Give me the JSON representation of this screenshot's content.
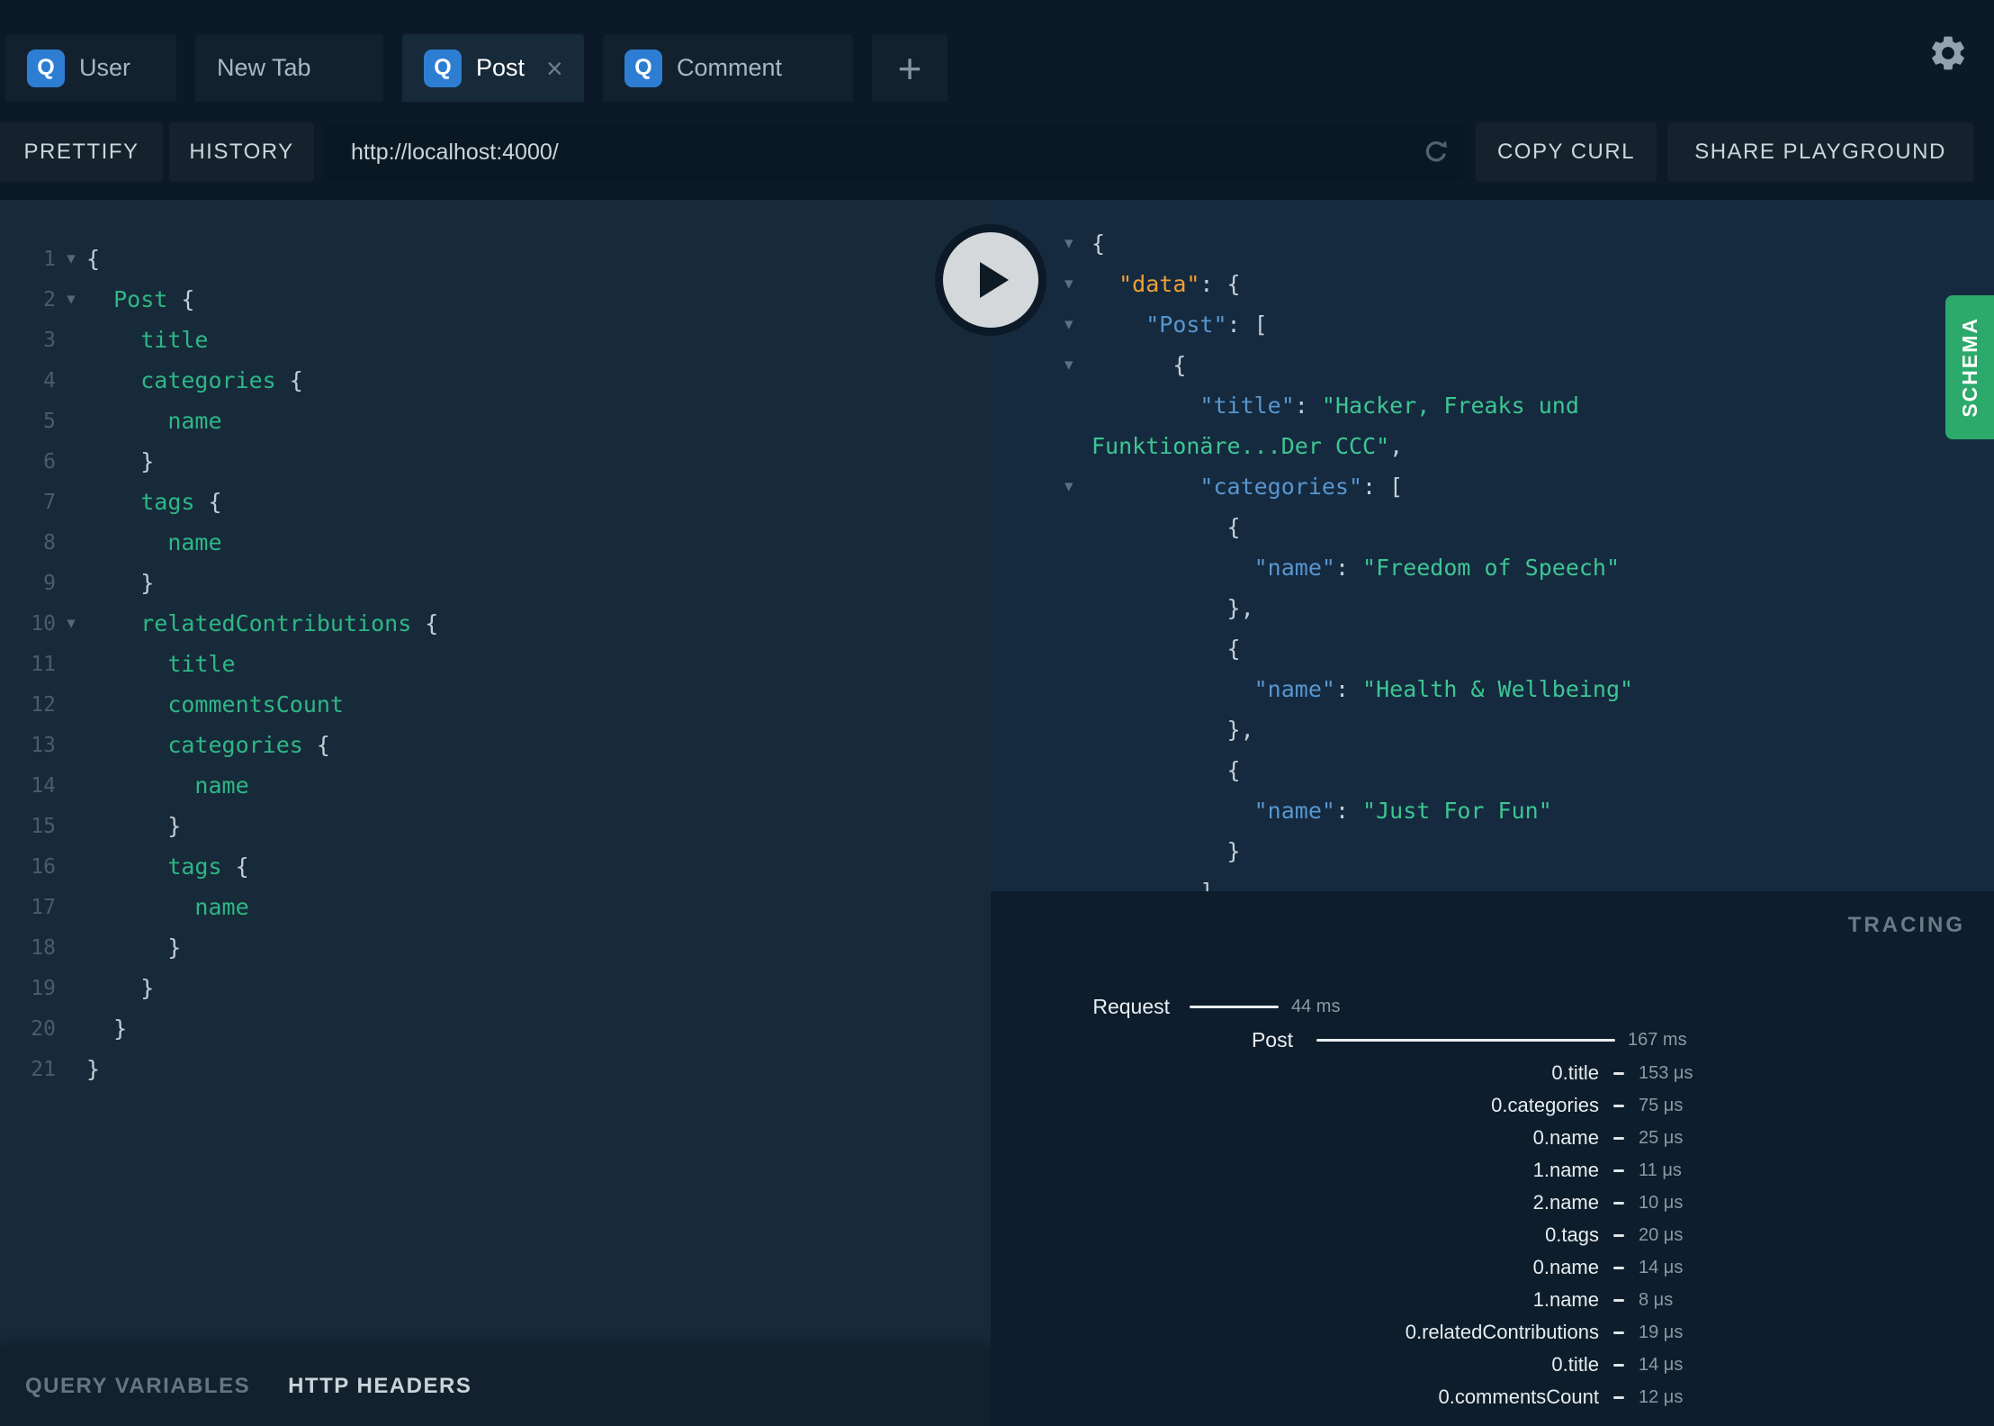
{
  "icons": {
    "q": "Q",
    "close": "×",
    "plus": "+",
    "fold": "▾"
  },
  "tabs": {
    "items": [
      {
        "label": "User",
        "active": false
      },
      {
        "label": "New Tab",
        "active": false
      },
      {
        "label": "Post",
        "active": true
      },
      {
        "label": "Comment",
        "active": false
      }
    ]
  },
  "toolbar": {
    "prettify": "PRETTIFY",
    "history": "HISTORY",
    "url": "http://localhost:4000/",
    "copy_curl": "COPY CURL",
    "share_playground": "SHARE PLAYGROUND"
  },
  "query_editor": {
    "lines": [
      {
        "n": "1",
        "fold": true,
        "tokens": [
          [
            "p",
            "{"
          ]
        ]
      },
      {
        "n": "2",
        "fold": true,
        "tokens": [
          [
            "p",
            "  "
          ],
          [
            "f",
            "Post"
          ],
          [
            "p",
            " {"
          ]
        ]
      },
      {
        "n": "3",
        "fold": false,
        "tokens": [
          [
            "p",
            "    "
          ],
          [
            "f",
            "title"
          ]
        ]
      },
      {
        "n": "4",
        "fold": false,
        "tokens": [
          [
            "p",
            "    "
          ],
          [
            "f",
            "categories"
          ],
          [
            "p",
            " {"
          ]
        ]
      },
      {
        "n": "5",
        "fold": false,
        "tokens": [
          [
            "p",
            "      "
          ],
          [
            "f",
            "name"
          ]
        ]
      },
      {
        "n": "6",
        "fold": false,
        "tokens": [
          [
            "p",
            "    }"
          ]
        ]
      },
      {
        "n": "7",
        "fold": false,
        "tokens": [
          [
            "p",
            "    "
          ],
          [
            "f",
            "tags"
          ],
          [
            "p",
            " {"
          ]
        ]
      },
      {
        "n": "8",
        "fold": false,
        "tokens": [
          [
            "p",
            "      "
          ],
          [
            "f",
            "name"
          ]
        ]
      },
      {
        "n": "9",
        "fold": false,
        "tokens": [
          [
            "p",
            "    }"
          ]
        ]
      },
      {
        "n": "10",
        "fold": true,
        "tokens": [
          [
            "p",
            "    "
          ],
          [
            "f",
            "relatedContributions"
          ],
          [
            "p",
            " {"
          ]
        ]
      },
      {
        "n": "11",
        "fold": false,
        "tokens": [
          [
            "p",
            "      "
          ],
          [
            "f",
            "title"
          ]
        ]
      },
      {
        "n": "12",
        "fold": false,
        "tokens": [
          [
            "p",
            "      "
          ],
          [
            "f",
            "commentsCount"
          ]
        ]
      },
      {
        "n": "13",
        "fold": false,
        "tokens": [
          [
            "p",
            "      "
          ],
          [
            "f",
            "categories"
          ],
          [
            "p",
            " {"
          ]
        ]
      },
      {
        "n": "14",
        "fold": false,
        "tokens": [
          [
            "p",
            "        "
          ],
          [
            "f",
            "name"
          ]
        ]
      },
      {
        "n": "15",
        "fold": false,
        "tokens": [
          [
            "p",
            "      }"
          ]
        ]
      },
      {
        "n": "16",
        "fold": false,
        "tokens": [
          [
            "p",
            "      "
          ],
          [
            "f",
            "tags"
          ],
          [
            "p",
            " {"
          ]
        ]
      },
      {
        "n": "17",
        "fold": false,
        "tokens": [
          [
            "p",
            "        "
          ],
          [
            "f",
            "name"
          ]
        ]
      },
      {
        "n": "18",
        "fold": false,
        "tokens": [
          [
            "p",
            "      }"
          ]
        ]
      },
      {
        "n": "19",
        "fold": false,
        "tokens": [
          [
            "p",
            "    }"
          ]
        ]
      },
      {
        "n": "20",
        "fold": false,
        "tokens": [
          [
            "p",
            "  }"
          ]
        ]
      },
      {
        "n": "21",
        "fold": false,
        "tokens": [
          [
            "p",
            "}"
          ]
        ]
      }
    ]
  },
  "response_viewer": {
    "lines": [
      {
        "fold": true,
        "tokens": [
          [
            "p",
            "{"
          ]
        ]
      },
      {
        "fold": true,
        "tokens": [
          [
            "p",
            "  "
          ],
          [
            "ko",
            "\"data\""
          ],
          [
            "p",
            ": {"
          ]
        ]
      },
      {
        "fold": true,
        "tokens": [
          [
            "p",
            "    "
          ],
          [
            "k",
            "\"Post\""
          ],
          [
            "p",
            ": ["
          ]
        ]
      },
      {
        "fold": true,
        "tokens": [
          [
            "p",
            "      {"
          ]
        ]
      },
      {
        "fold": false,
        "tokens": [
          [
            "p",
            "        "
          ],
          [
            "k",
            "\"title\""
          ],
          [
            "p",
            ": "
          ],
          [
            "s",
            "\"Hacker, Freaks und Funktionäre...Der CCC\""
          ],
          [
            "p",
            ","
          ]
        ]
      },
      {
        "fold": true,
        "tokens": [
          [
            "p",
            "        "
          ],
          [
            "k",
            "\"categories\""
          ],
          [
            "p",
            ": ["
          ]
        ]
      },
      {
        "fold": false,
        "tokens": [
          [
            "p",
            "          {"
          ]
        ]
      },
      {
        "fold": false,
        "tokens": [
          [
            "p",
            "            "
          ],
          [
            "k",
            "\"name\""
          ],
          [
            "p",
            ": "
          ],
          [
            "s",
            "\"Freedom of Speech\""
          ]
        ]
      },
      {
        "fold": false,
        "tokens": [
          [
            "p",
            "          },"
          ]
        ]
      },
      {
        "fold": false,
        "tokens": [
          [
            "p",
            "          {"
          ]
        ]
      },
      {
        "fold": false,
        "tokens": [
          [
            "p",
            "            "
          ],
          [
            "k",
            "\"name\""
          ],
          [
            "p",
            ": "
          ],
          [
            "s",
            "\"Health & Wellbeing\""
          ]
        ]
      },
      {
        "fold": false,
        "tokens": [
          [
            "p",
            "          },"
          ]
        ]
      },
      {
        "fold": false,
        "tokens": [
          [
            "p",
            "          {"
          ]
        ]
      },
      {
        "fold": false,
        "tokens": [
          [
            "p",
            "            "
          ],
          [
            "k",
            "\"name\""
          ],
          [
            "p",
            ": "
          ],
          [
            "s",
            "\"Just For Fun\""
          ]
        ]
      },
      {
        "fold": false,
        "tokens": [
          [
            "p",
            "          }"
          ]
        ]
      },
      {
        "fold": false,
        "tokens": [
          [
            "p",
            "        ]"
          ]
        ]
      }
    ]
  },
  "tracing": {
    "title": "TRACING",
    "request": {
      "label": "Request",
      "time": "44 ms"
    },
    "root": {
      "label": "Post",
      "time": "167 ms"
    },
    "rows": [
      {
        "label": "0.title",
        "time": "153 μs"
      },
      {
        "label": "0.categories",
        "time": "75 μs"
      },
      {
        "label": "0.name",
        "time": "25 μs"
      },
      {
        "label": "1.name",
        "time": "11 μs"
      },
      {
        "label": "2.name",
        "time": "10 μs"
      },
      {
        "label": "0.tags",
        "time": "20 μs"
      },
      {
        "label": "0.name",
        "time": "14 μs"
      },
      {
        "label": "1.name",
        "time": "8 μs"
      },
      {
        "label": "0.relatedContributions",
        "time": "19 μs"
      },
      {
        "label": "0.title",
        "time": "14 μs"
      },
      {
        "label": "0.commentsCount",
        "time": "12 μs"
      }
    ]
  },
  "bottom_bar": {
    "query_variables": "QUERY VARIABLES",
    "http_headers": "HTTP HEADERS"
  },
  "schema_button": {
    "label": "SCHEMA"
  },
  "colors": {
    "accent_blue": "#2d7ed2",
    "field_green": "#2eb785",
    "key_blue": "#5896ce",
    "data_orange": "#efa032",
    "string_green": "#3ec593",
    "schema_green": "#2baa6b",
    "editor_bg": "#172a3a",
    "topbar_bg": "#0c1926",
    "tracing_bg": "#0d1d2c"
  }
}
